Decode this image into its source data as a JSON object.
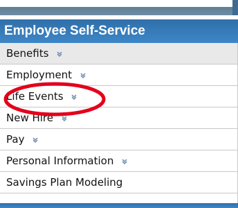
{
  "panel": {
    "title": "Employee Self-Service",
    "items": [
      {
        "label": "Benefits",
        "has_submenu": true,
        "selected": true
      },
      {
        "label": "Employment",
        "has_submenu": true,
        "selected": false
      },
      {
        "label": "Life Events",
        "has_submenu": true,
        "selected": false
      },
      {
        "label": "New Hire",
        "has_submenu": true,
        "selected": false
      },
      {
        "label": "Pay",
        "has_submenu": true,
        "selected": false
      },
      {
        "label": "Personal Information",
        "has_submenu": true,
        "selected": false
      },
      {
        "label": "Savings Plan Modeling",
        "has_submenu": false,
        "selected": false
      }
    ]
  },
  "annotation": {
    "shape": "ellipse",
    "color": "#e3001b",
    "target": "Life Events"
  },
  "colors": {
    "header_blue": "#3e86c8",
    "selected_row": "#e9e9e9",
    "chevron": "#7a95b5"
  },
  "icons": {
    "submenu": "double-chevron-down-icon"
  }
}
